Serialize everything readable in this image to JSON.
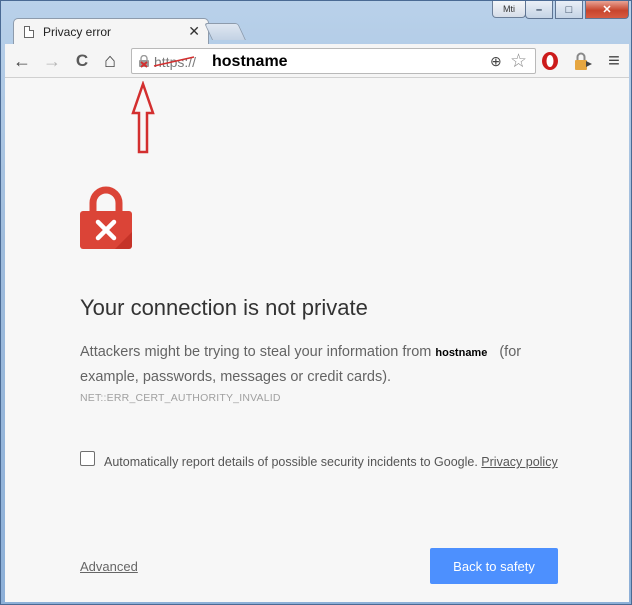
{
  "window": {
    "user_badge": "Mti",
    "minimize_glyph": "–",
    "maximize_glyph": "□",
    "close_glyph": "✕"
  },
  "tab": {
    "title": "Privacy error",
    "close_glyph": "✕"
  },
  "toolbar": {
    "back_glyph": "←",
    "forward_glyph": "→",
    "reload_glyph": "C",
    "home_glyph": "⌂",
    "url_scheme": "https://",
    "url_host": "hostname",
    "zoom_glyph": "⊕",
    "star_glyph": "☆",
    "menu_glyph": "≡"
  },
  "page": {
    "heading": "Your connection is not private",
    "desc_before": "Attackers might be trying to steal your information from",
    "desc_host": "hostname",
    "desc_after": "(for example, passwords, messages or credit cards).",
    "error_code": "NET::ERR_CERT_AUTHORITY_INVALID",
    "report_text": "Automatically report details of possible security incidents to Google.",
    "privacy_link": "Privacy policy",
    "advanced_link": "Advanced",
    "safety_button": "Back to safety"
  },
  "colors": {
    "accent_button": "#4d90fe",
    "lock_red": "#db4437",
    "annotation_red": "#d32f2f"
  }
}
